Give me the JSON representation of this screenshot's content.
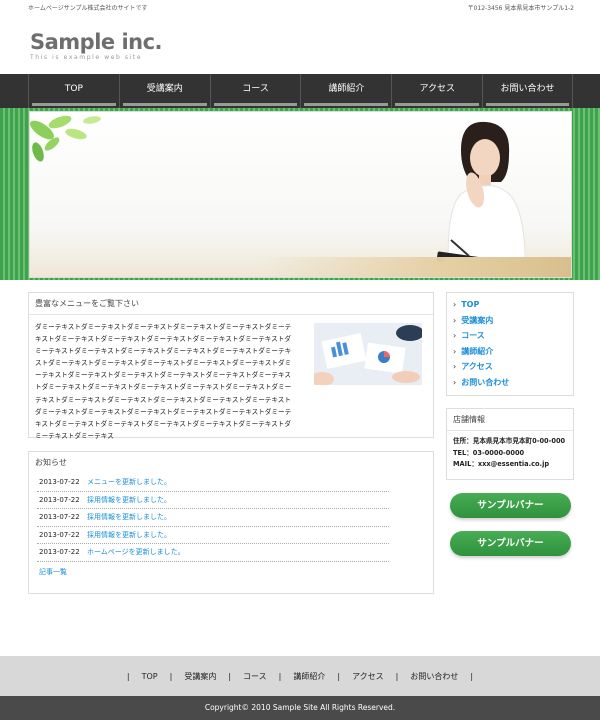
{
  "header": {
    "tagline": "ホームページサンプル株式会社のサイトです",
    "address": "〒012-3456 見本県見本市サンプル1-2",
    "logo_name": "Sample inc.",
    "logo_sub": "This is example web site"
  },
  "gnav": [
    "TOP",
    "受講案内",
    "コース",
    "講師紹介",
    "アクセス",
    "お問い合わせ"
  ],
  "main": {
    "heading": "豊富なメニューをご覧下さい",
    "body": "ダミーテキストダミーテキストダミーテキストダミーテキストダミーテキストダミーテキストダミーテキストダミーテキストダミーテキストダミーテキストダミーテキストダミーテキストダミーテキストダミーテキストダミーテキストダミーテキストダミーテキストダミーテキストダミーテキストダミーテキストダミーテキストダミーテキストダミーテキストダミーテキストダミーテキストダミーテキストダミーテキストダミーテキストダミーテキストダミーテキストダミーテキストダミーテキストダミーテキストダミーテキストダミーテキストダミーテキストダミーテキストダミーテキストダミーテキストダミーテキストダミーテキストダミーテキストダミーテキストダミーテキストダミーテキストダミーテキストダミーテキストダミーテキストダミーテキストダミーテキストダミーテキストダミーテキス"
  },
  "news": {
    "heading": "お知らせ",
    "items": [
      {
        "date": "2013-07-22",
        "title": "メニューを更新しました。"
      },
      {
        "date": "2013-07-22",
        "title": "採用情報を更新しました。"
      },
      {
        "date": "2013-07-22",
        "title": "採用情報を更新しました。"
      },
      {
        "date": "2013-07-22",
        "title": "採用情報を更新しました。"
      },
      {
        "date": "2013-07-22",
        "title": "ホームページを更新しました。"
      }
    ],
    "archive": "記事一覧"
  },
  "side_nav": [
    "TOP",
    "受講案内",
    "コース",
    "講師紹介",
    "アクセス",
    "お問い合わせ"
  ],
  "shop": {
    "heading": "店舗情報",
    "address": "住所：見本県見本市見本町0-00-000",
    "tel": "TEL：03-0000-0000",
    "mail": "MAIL：xxx@essentia.co.jp"
  },
  "banners": [
    "サンプルバナー",
    "サンプルバナー"
  ],
  "footer": {
    "nav": [
      "TOP",
      "受講案内",
      "コース",
      "講師紹介",
      "アクセス",
      "お問い合わせ"
    ],
    "copyright": "Copyright© 2010 Sample Site All Rights Reserved."
  },
  "colors": {
    "accent": "#1a8ed8",
    "green": "#3fa34d",
    "nav_bg": "#333333"
  }
}
